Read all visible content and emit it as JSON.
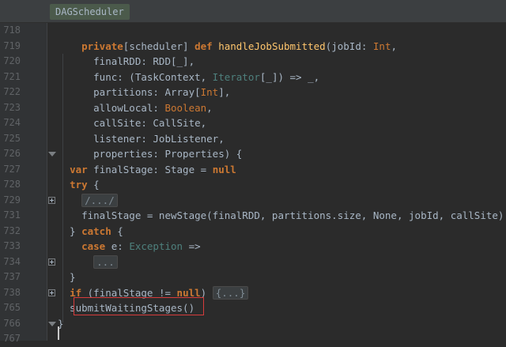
{
  "breadcrumb": "DAGScheduler",
  "lines": [
    {
      "no": "718",
      "parts": []
    },
    {
      "no": "719",
      "parts": [
        [
          "    ",
          ""
        ],
        [
          "private",
          "kw"
        ],
        [
          "[scheduler] ",
          ""
        ],
        [
          "def",
          "kw"
        ],
        [
          " ",
          ""
        ],
        [
          "handleJobSubmitted",
          "fn"
        ],
        [
          "(jobId: ",
          ""
        ],
        [
          "Int",
          "tp"
        ],
        [
          ",",
          ""
        ]
      ]
    },
    {
      "no": "720",
      "parts": [
        [
          "      finalRDD: RDD[_],",
          ""
        ]
      ]
    },
    {
      "no": "721",
      "parts": [
        [
          "      func: (TaskContext, ",
          ""
        ],
        [
          "Iterator",
          "gn"
        ],
        [
          "[_]) => _,",
          ""
        ]
      ]
    },
    {
      "no": "722",
      "parts": [
        [
          "      partitions: Array[",
          ""
        ],
        [
          "Int",
          "tp"
        ],
        [
          "],",
          ""
        ]
      ]
    },
    {
      "no": "723",
      "parts": [
        [
          "      allowLocal: ",
          ""
        ],
        [
          "Boolean",
          "tp"
        ],
        [
          ",",
          ""
        ]
      ]
    },
    {
      "no": "724",
      "parts": [
        [
          "      callSite: CallSite,",
          ""
        ]
      ]
    },
    {
      "no": "725",
      "parts": [
        [
          "      listener: JobListener,",
          ""
        ]
      ]
    },
    {
      "no": "726",
      "parts": [
        [
          "      properties: Properties) {",
          ""
        ]
      ]
    },
    {
      "no": "727",
      "parts": [
        [
          "  ",
          ""
        ],
        [
          "var",
          "kw"
        ],
        [
          " finalStage: Stage = ",
          ""
        ],
        [
          "null",
          "kw"
        ]
      ]
    },
    {
      "no": "728",
      "parts": [
        [
          "  ",
          ""
        ],
        [
          "try",
          "kw"
        ],
        [
          " {",
          ""
        ]
      ]
    },
    {
      "no": "729",
      "parts": [
        [
          "    ",
          ""
        ],
        [
          "/.../",
          "fold"
        ]
      ]
    },
    {
      "no": "731",
      "parts": [
        [
          "    finalStage = newStage(finalRDD, partitions.size, None, jobId, callSite)",
          ""
        ]
      ]
    },
    {
      "no": "732",
      "parts": [
        [
          "  } ",
          ""
        ],
        [
          "catch",
          "kw"
        ],
        [
          " {",
          ""
        ]
      ]
    },
    {
      "no": "733",
      "parts": [
        [
          "    ",
          ""
        ],
        [
          "case",
          "kw"
        ],
        [
          " e: ",
          ""
        ],
        [
          "Exception",
          "gn"
        ],
        [
          " =>",
          ""
        ]
      ]
    },
    {
      "no": "734",
      "parts": [
        [
          "      ",
          ""
        ],
        [
          "...",
          "fold"
        ]
      ]
    },
    {
      "no": "737",
      "parts": [
        [
          "  }",
          ""
        ]
      ]
    },
    {
      "no": "738",
      "parts": [
        [
          "  ",
          ""
        ],
        [
          "if",
          "kw"
        ],
        [
          " (finalStage != ",
          ""
        ],
        [
          "null",
          "kw"
        ],
        [
          ") ",
          ""
        ],
        [
          "{...}",
          "fold"
        ]
      ]
    },
    {
      "no": "765",
      "parts": [
        [
          "  submitWaitingStages()",
          ""
        ]
      ]
    },
    {
      "no": "766",
      "parts": [
        [
          "}",
          ""
        ]
      ]
    },
    {
      "no": "767",
      "parts": []
    }
  ],
  "fold_markers": {
    "726": "end",
    "729": "plus",
    "734": "plus",
    "738": "plus",
    "766": "end"
  },
  "colors": {
    "keyword": "#cc7832",
    "function": "#ffc66d",
    "highlight": "#d63c3c"
  }
}
